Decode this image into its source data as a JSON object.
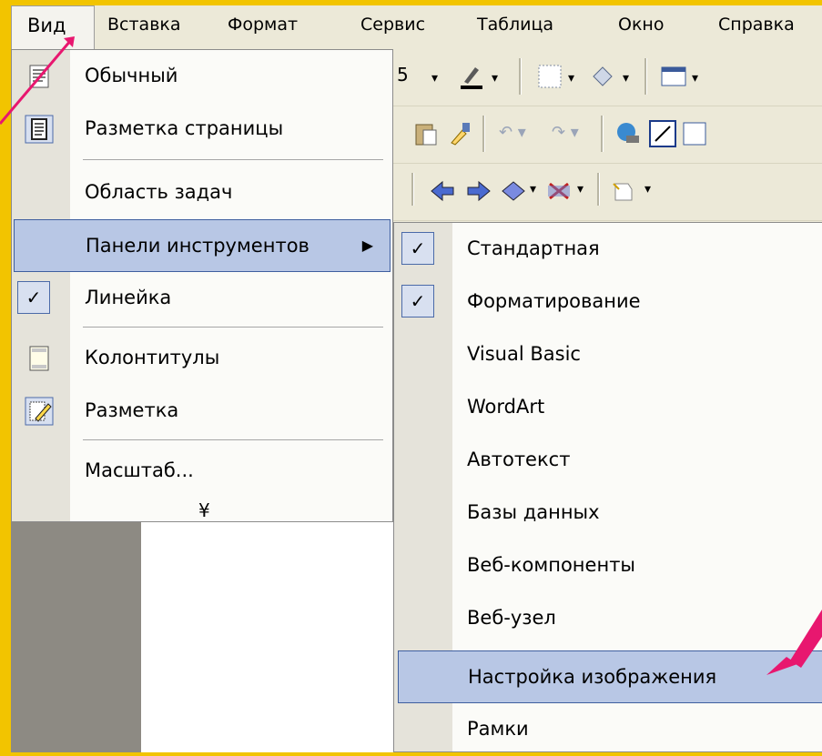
{
  "menubar": {
    "items": [
      "Вид",
      "Вставка",
      "Формат",
      "Сервис",
      "Таблица",
      "Окно",
      "Справка"
    ]
  },
  "toolbar": {
    "font_size_partial": "5"
  },
  "view_menu": {
    "items": [
      {
        "label": "Обычный",
        "icon": "normal-view-icon"
      },
      {
        "label": "Разметка страницы",
        "icon": "page-layout-icon"
      },
      {
        "label": "Область задач"
      },
      {
        "label": "Панели инструментов",
        "submenu": true,
        "highlighted": true
      },
      {
        "label": "Линейка",
        "checked": true
      },
      {
        "label": "Колонтитулы",
        "icon": "header-footer-icon"
      },
      {
        "label": "Разметка",
        "icon": "markup-icon"
      },
      {
        "label": "Масштаб..."
      }
    ],
    "expand_icon": "chevron-double-down-icon"
  },
  "toolbars_submenu": {
    "items": [
      {
        "label": "Стандартная",
        "checked": true
      },
      {
        "label": "Форматирование",
        "checked": true
      },
      {
        "label": "Visual Basic"
      },
      {
        "label": "WordArt"
      },
      {
        "label": "Автотекст"
      },
      {
        "label": "Базы данных"
      },
      {
        "label": "Веб-компоненты"
      },
      {
        "label": "Веб-узел"
      },
      {
        "label": "Настройка изображения",
        "highlighted": true
      },
      {
        "label": "Рамки"
      }
    ]
  },
  "colors": {
    "background": "#f2c400",
    "menu_highlight": "#b8c7e5",
    "pink_arrow": "#e8176f"
  }
}
